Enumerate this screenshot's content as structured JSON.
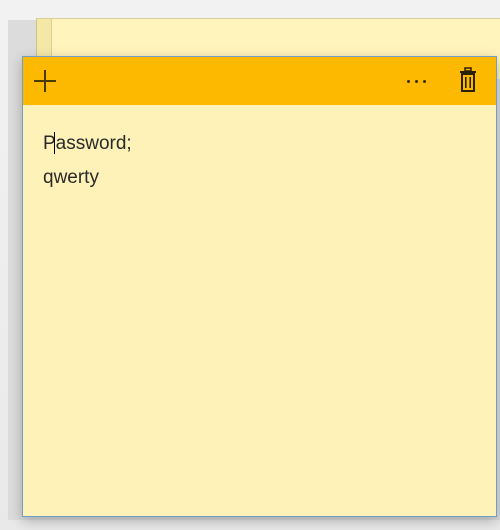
{
  "note": {
    "lines": [
      "Password;",
      "qwerty"
    ]
  },
  "toolbar": {
    "add_icon": "plus-icon",
    "more_icon": "ellipsis-icon",
    "delete_icon": "trash-icon"
  },
  "colors": {
    "header": "#fcb900",
    "note_background": "#fff2b8",
    "border": "#6e9fc9"
  }
}
